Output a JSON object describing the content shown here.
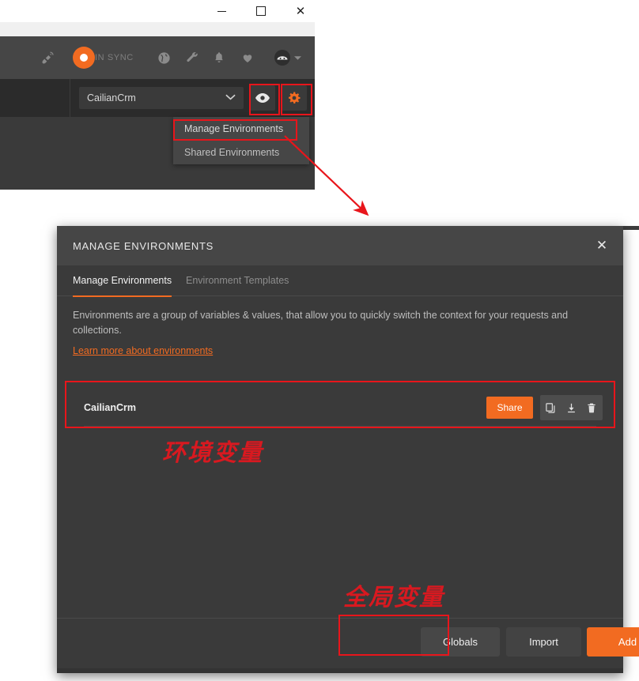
{
  "window": {
    "controls": [
      {
        "name": "minimize",
        "glyph": "—"
      },
      {
        "name": "maximize",
        "glyph": "□"
      },
      {
        "name": "close",
        "glyph": "✕"
      }
    ]
  },
  "app_toolbar": {
    "sync_status": "IN SYNC",
    "icons": [
      "satellite-icon",
      "sync-logo-icon",
      "globe-icon",
      "wrench-icon",
      "bell-icon",
      "heart-icon",
      "avatar-icon",
      "caret-down-icon"
    ]
  },
  "env_bar": {
    "selected_environment": "CailianCrm",
    "caret": "⌄",
    "eye_icon": "eye-icon",
    "gear_icon": "gear-icon"
  },
  "gear_menu": {
    "items": [
      {
        "label": "Manage Environments"
      },
      {
        "label": "Shared Environments"
      }
    ]
  },
  "dialog": {
    "title": "MANAGE ENVIRONMENTS",
    "close_glyph": "✕",
    "tabs": [
      {
        "label": "Manage Environments",
        "active": true
      },
      {
        "label": "Environment Templates",
        "active": false
      }
    ],
    "description": "Environments are a group of variables & values, that allow you to quickly switch the context for your requests and collections.",
    "learn_more": "Learn more about environments",
    "environments": [
      {
        "name": "CailianCrm",
        "share_label": "Share",
        "actions": [
          "copy-icon",
          "download-icon",
          "delete-icon"
        ]
      }
    ],
    "footer_buttons": [
      {
        "label": "Globals"
      },
      {
        "label": "Import"
      },
      {
        "label": "Add"
      }
    ]
  },
  "annotations": {
    "note_environment_variables": "环境变量",
    "note_global_variables": "全局变量",
    "highlight_color": "#e8151b",
    "accent_color": "#f26b21"
  }
}
